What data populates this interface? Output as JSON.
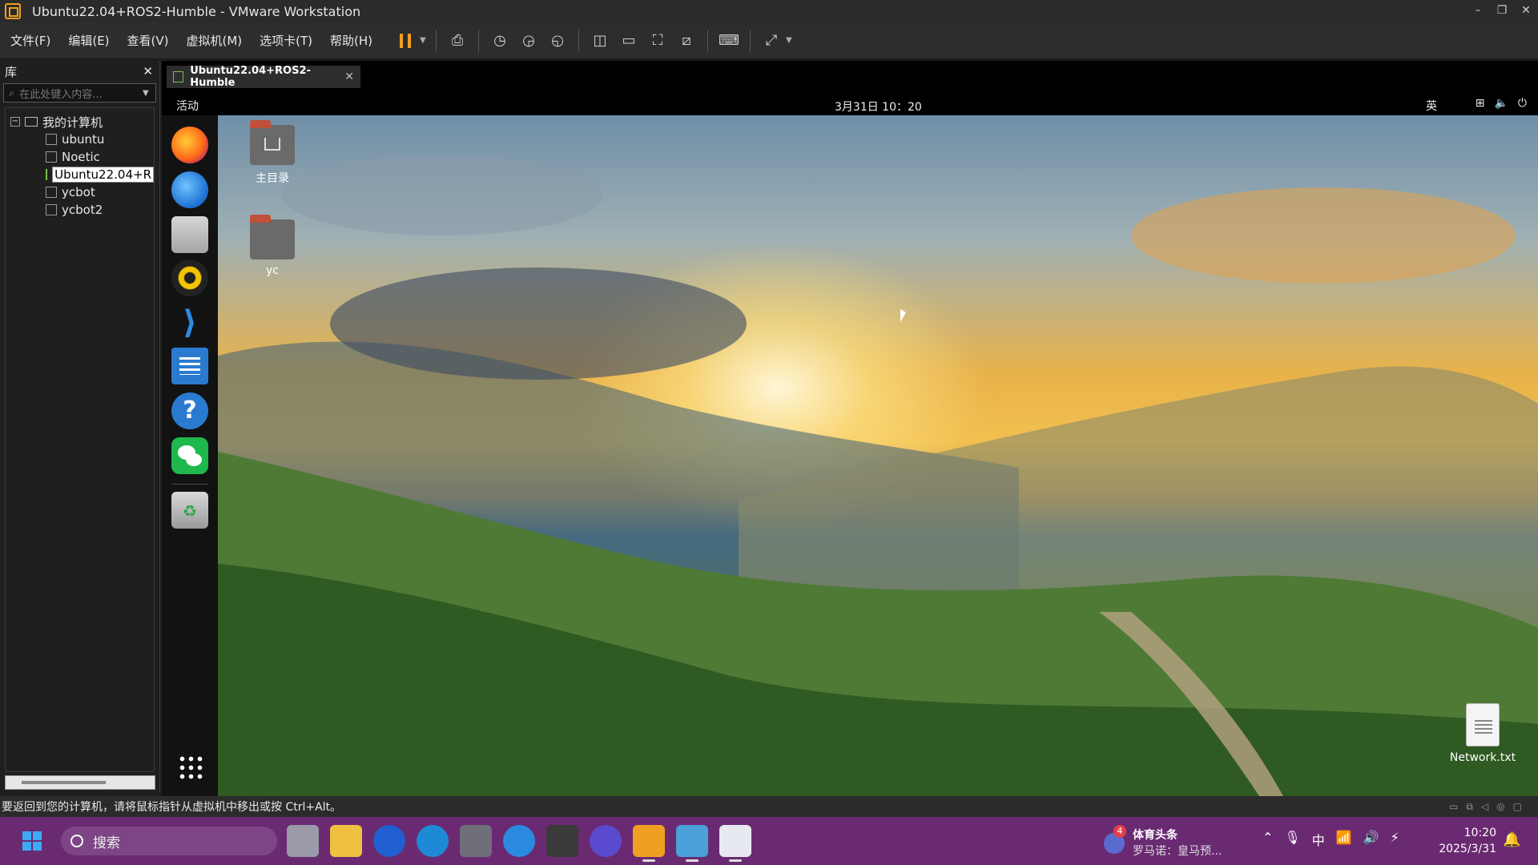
{
  "window": {
    "title": "Ubuntu22.04+ROS2-Humble - VMware Workstation",
    "controls": [
      "–",
      "❐",
      "✕"
    ]
  },
  "menu": [
    "文件(F)",
    "编辑(E)",
    "查看(V)",
    "虚拟机(M)",
    "选项卡(T)",
    "帮助(H)"
  ],
  "library": {
    "title": "库",
    "close": "✕",
    "search_placeholder": "在此处键入内容...",
    "root": "我的计算机",
    "vms": [
      "ubuntu",
      "Noetic",
      "Ubuntu22.04+R",
      "ycbot",
      "ycbot2"
    ],
    "selected_index": 2
  },
  "vm_tab": {
    "label": "Ubuntu22.04+ROS2-Humble",
    "close": "✕"
  },
  "gnome": {
    "activities": "活动",
    "clock": "3月31日  10：20",
    "input_method": "英",
    "tray": [
      "network-icon",
      "volume-icon",
      "power-icon"
    ]
  },
  "dock": [
    "firefox",
    "thunderbird",
    "files",
    "rhythmbox",
    "vscode",
    "libreoffice-writer",
    "help",
    "wechat",
    "trash",
    "show-apps"
  ],
  "desktop_icons": {
    "home": "主目录",
    "yc": "yc",
    "network": "Network.txt"
  },
  "statusbar": {
    "message": "要返回到您的计算机，请将鼠标指针从虚拟机中移出或按 Ctrl+Alt。"
  },
  "taskbar": {
    "search": "搜索",
    "news_badge": "4",
    "news_title": "体育头条",
    "news_sub": "罗马诺：皇马预...",
    "ime": "中",
    "time": "10:20",
    "date": "2025/3/31"
  }
}
